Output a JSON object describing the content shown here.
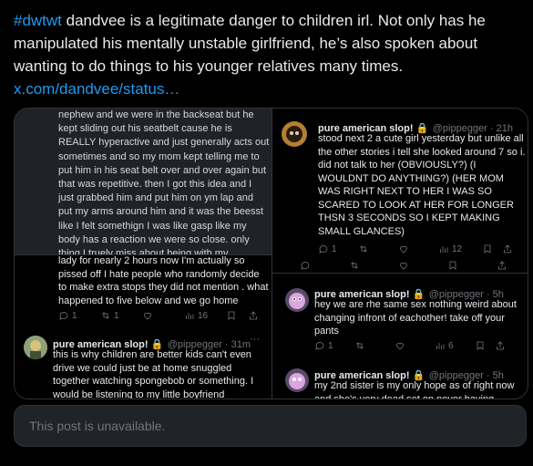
{
  "post": {
    "hashtag": "#dwtwt",
    "text": " dandvee is a legitimate danger to children irl. Not only has he manipulated his mentally unstable girlfriend, he’s also spoken about wanting to do things to his younger relatives many times.",
    "link": "x.com/dandvee/status…"
  },
  "panel1": {
    "text": "nephew and we were in the backseat but he kept sliding out his seatbelt cause he is REALLY hyperactive and just generally acts out sometimes and so my mom kept telling me to put him in his seat belt over and over again but that was repetitive. then I got this idea and I just grabbed him and put him on ym lap and put my arms around him and it was the beesst like I felt somethign I was like gasp like my body has a reaction we were so close. only thing I truely miss about being with my"
  },
  "panel2": {
    "tweet_a_text": "lady for nearly 2 hours now I'm actually so pissed off I hate people who randomly decide to make extra stops they did not mention . what happened to five below and we go home",
    "tweet_a_stats": {
      "replies": "1",
      "retweets": "1",
      "views": "16"
    },
    "tweet_b_name": "pure american slop! 🔒",
    "tweet_b_handle": "@pippegger · 31m",
    "tweet_b_text": "this is why children are better kids can't even drive we could just be at home snuggled together watching spongebob or something. I would be listening to my little boyfriend"
  },
  "panel3": {
    "name": "pure american slop! 🔒",
    "handle": "@pippegger · 21h",
    "text": "stood next 2 a cute girl yesterday but unlike all the other stories i tell she looked around 7 so i. did not talk to her (OBVIOUSLY?) (I WOULDNT DO ANYTHING?) (HER MOM WAS RIGHT NEXT TO HER I WAS SO SCARED TO LOOK AT HER FOR LONGER THSN 3 SECONDS SO I KEPT MAKING SMALL GLANCES)",
    "stats": {
      "replies": "1",
      "views": "12"
    }
  },
  "panel4": {
    "tweet_a_name": "pure american slop! 🔒",
    "tweet_a_handle": "@pippegger · 5h",
    "tweet_a_text": "hey we are rhe same sex nothing weird about changing infront of eachother! take off your pants",
    "tweet_a_stats": {
      "replies": "1",
      "views": "6"
    },
    "tweet_b_name": "pure american slop! 🔒",
    "tweet_b_handle": "@pippegger · 5h",
    "tweet_b_text": "my 2nd sister is my only hope as of right now and she's very dead set on never having"
  },
  "unavailable": "This post is unavailable.",
  "icons": {
    "more": "···"
  },
  "colors": {
    "accent": "#1d9bf0",
    "muted": "#71767b",
    "text": "#e7e9ea"
  }
}
